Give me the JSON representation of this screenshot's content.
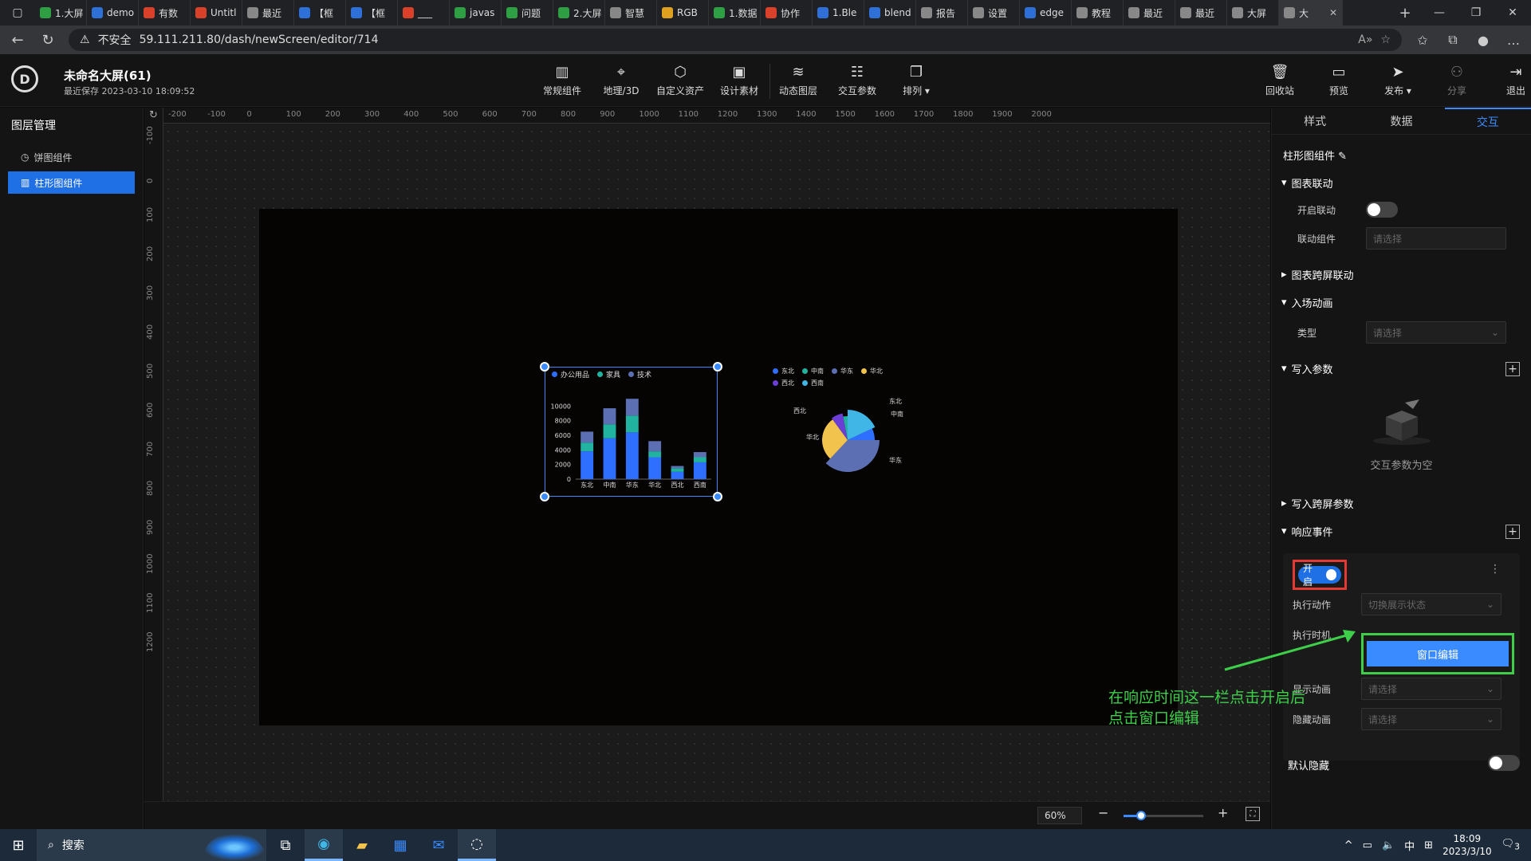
{
  "browser": {
    "tabs": [
      {
        "label": "1.大屏",
        "color": "#2ea043"
      },
      {
        "label": "demo",
        "color": "#2f6fd8"
      },
      {
        "label": "有数",
        "color": "#d9412b"
      },
      {
        "label": "Untitl",
        "color": "#d9412b"
      },
      {
        "label": "最近",
        "color": "#888888"
      },
      {
        "label": "【框",
        "color": "#2f6fd8"
      },
      {
        "label": "【框",
        "color": "#2f6fd8"
      },
      {
        "label": "___",
        "color": "#d9412b"
      },
      {
        "label": "javas",
        "color": "#2ea043"
      },
      {
        "label": "问题",
        "color": "#2ea043"
      },
      {
        "label": "2.大屏",
        "color": "#2ea043"
      },
      {
        "label": "智慧",
        "color": "#888888"
      },
      {
        "label": "RGB",
        "color": "#e0a020"
      },
      {
        "label": "1.数据",
        "color": "#2ea043"
      },
      {
        "label": "协作",
        "color": "#d9412b"
      },
      {
        "label": "1.Ble",
        "color": "#2f6fd8"
      },
      {
        "label": "blend",
        "color": "#2f6fd8"
      },
      {
        "label": "报告",
        "color": "#888888"
      },
      {
        "label": "设置",
        "color": "#888888"
      },
      {
        "label": "edge",
        "color": "#2f6fd8"
      },
      {
        "label": "教程",
        "color": "#888888"
      },
      {
        "label": "最近",
        "color": "#888888"
      },
      {
        "label": "最近",
        "color": "#888888"
      },
      {
        "label": "大屏",
        "color": "#888888"
      },
      {
        "label": "大",
        "color": "#888888"
      }
    ],
    "insecure_label": "不安全",
    "url": "59.111.211.80/dash/newScreen/editor/714"
  },
  "header": {
    "title": "未命名大屏(61)",
    "saved": "最近保存 2023-03-10 18:09:52",
    "tools": [
      {
        "label": "常规组件",
        "icon": "bar-chart-icon",
        "glyph": "▥"
      },
      {
        "label": "地理/3D",
        "icon": "map-pin-icon",
        "glyph": "⌖"
      },
      {
        "label": "自定义资产",
        "icon": "hexagon-icon",
        "glyph": "⬡"
      },
      {
        "label": "设计素材",
        "icon": "image-icon",
        "glyph": "▣"
      },
      {
        "label": "动态图层",
        "icon": "layers-icon",
        "glyph": "≋"
      },
      {
        "label": "交互参数",
        "icon": "sliders-icon",
        "glyph": "☷"
      },
      {
        "label": "排列 ▾",
        "icon": "arrange-icon",
        "glyph": "❐"
      }
    ],
    "right_tools": [
      {
        "label": "回收站",
        "icon": "trash-icon",
        "glyph": "🗑"
      },
      {
        "label": "预览",
        "icon": "monitor-icon",
        "glyph": "▭"
      },
      {
        "label": "发布 ▾",
        "icon": "send-icon",
        "glyph": "➤"
      },
      {
        "label": "分享",
        "icon": "share-icon",
        "glyph": "⚇"
      },
      {
        "label": "退出",
        "icon": "exit-icon",
        "glyph": "⇥"
      }
    ]
  },
  "layers": {
    "title": "图层管理",
    "items": [
      {
        "label": "饼图组件",
        "icon": "pie-icon",
        "glyph": "◷"
      },
      {
        "label": "柱形图组件",
        "icon": "bar-icon",
        "glyph": "▥"
      }
    ]
  },
  "rulers": {
    "h": [
      "-200",
      "-100",
      "0",
      "100",
      "200",
      "300",
      "400",
      "500",
      "600",
      "700",
      "800",
      "900",
      "1000",
      "1100",
      "1200",
      "1300",
      "1400",
      "1500",
      "1600",
      "1700",
      "1800",
      "1900",
      "2000"
    ],
    "v": [
      "-100",
      "0",
      "100",
      "200",
      "300",
      "400",
      "500",
      "600",
      "700",
      "800",
      "900",
      "1000",
      "1100",
      "1200"
    ]
  },
  "bar_chart": {
    "legend": [
      {
        "name": "办公用品",
        "color": "#2f6fff"
      },
      {
        "name": "家具",
        "color": "#22b3a0"
      },
      {
        "name": "技术",
        "color": "#5d6fb3"
      }
    ],
    "y_ticks": [
      "10000",
      "8000",
      "6000",
      "4000",
      "2000",
      "0"
    ],
    "categories": [
      "东北",
      "中南",
      "华东",
      "华北",
      "西北",
      "西南"
    ],
    "series": [
      {
        "name": "办公用品",
        "color": "#2f6fff",
        "values": [
          3800,
          5600,
          6400,
          3000,
          1000,
          2300
        ]
      },
      {
        "name": "家具",
        "color": "#22b3a0",
        "values": [
          1200,
          1900,
          2300,
          800,
          500,
          700
        ]
      },
      {
        "name": "技术",
        "color": "#5d6fb3",
        "values": [
          1500,
          2200,
          2300,
          1400,
          300,
          700
        ]
      }
    ],
    "ymax": 12000
  },
  "pie_chart": {
    "legend": [
      {
        "name": "东北",
        "color": "#2f6fff"
      },
      {
        "name": "中南",
        "color": "#22b3a0"
      },
      {
        "name": "华东",
        "color": "#5d6fb3"
      },
      {
        "name": "华北",
        "color": "#f2c44d"
      },
      {
        "name": "西北",
        "color": "#6b3fd6"
      },
      {
        "name": "西南",
        "color": "#3fb6e6"
      }
    ],
    "labels": [
      "东北",
      "中南",
      "华东",
      "华北",
      "西北"
    ]
  },
  "right_panel": {
    "tabs": [
      "样式",
      "数据",
      "交互"
    ],
    "component_name": "柱形图组件",
    "sections": {
      "chart_link": "图表联动",
      "enable_link": "开启联动",
      "link_component": "联动组件",
      "placeholder": "请选择",
      "cross_link": "图表跨屏联动",
      "entry_anim": "入场动画",
      "type": "类型",
      "write_params": "写入参数",
      "empty_params": "交互参数为空",
      "write_cross": "写入跨屏参数",
      "events": "响应事件",
      "open": "开启",
      "exec_action": "执行动作",
      "exec_action_val": "切换展示状态",
      "exec_time": "执行时机",
      "window_edit": "窗口编辑",
      "show_anim": "显示动画",
      "hide_anim": "隐藏动画",
      "default_hidden": "默认隐藏"
    }
  },
  "annotation": {
    "line1": "在响应时间这一栏点击开启后",
    "line2": "点击窗口编辑"
  },
  "zoom": {
    "value": "60%",
    "level": 0.22
  },
  "taskbar": {
    "search": "搜索",
    "time": "18:09",
    "date": "2023/3/10",
    "ime": "中",
    "notif": "3"
  }
}
